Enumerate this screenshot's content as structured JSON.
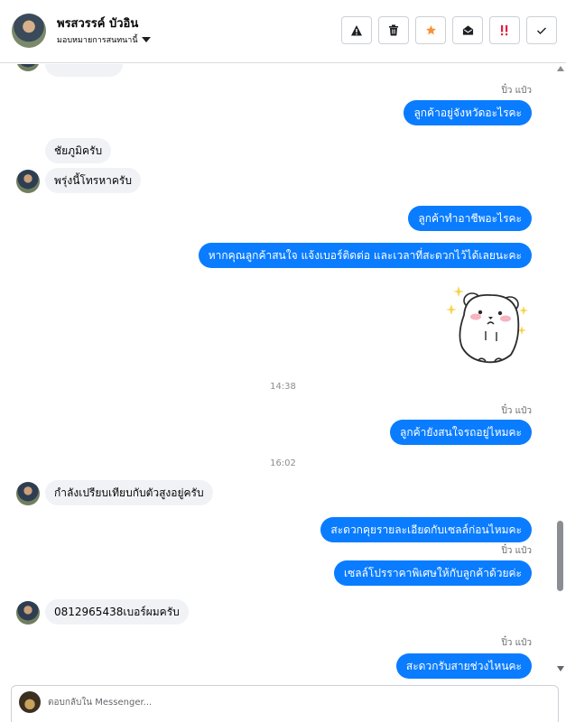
{
  "header": {
    "contact_name": "พรสวรรค์ บัวอิน",
    "assign_label": "มอบหมายการสนทนานี้",
    "actions": [
      {
        "name": "spam-button",
        "icon": "warning-icon"
      },
      {
        "name": "delete-button",
        "icon": "trash-icon"
      },
      {
        "name": "star-button",
        "icon": "star-icon",
        "color": "#f7923a"
      },
      {
        "name": "mark-unread-button",
        "icon": "envelope-open-icon"
      },
      {
        "name": "follow-up-button",
        "icon": "exclamation-icon",
        "color": "#e41e3f"
      },
      {
        "name": "mark-done-button",
        "icon": "check-icon"
      }
    ]
  },
  "messages": {
    "m1_sender": "ปิ๋ว แป๋ว",
    "m1": "ลูกค้าอยู่จังหวัดอะไรคะ",
    "m2": "ชัยภูมิครับ",
    "m3": "พรุ่งนี้โทรหาครับ",
    "m4": "ลูกค้าทำอาชีพอะไรคะ",
    "m5": "หากคุณลูกค้าสนใจ  แจ้งเบอร์ติดต่อ  และเวลาที่สะดวกไว้ได้เลยนะคะ",
    "time1": "14:38",
    "m6_sender": "ปิ๋ว แป๋ว",
    "m6": "ลูกค้ายังสนใจรถอยู่ไหมคะ",
    "time2": "16:02",
    "m7": "กำลังเปรียบเทียบกับตัวสูงอยู่ครับ",
    "m8": "สะดวกคุยรายละเอียดกับเซลล์ก่อนไหมคะ",
    "m9_sender": "ปิ๋ว แป๋ว",
    "m9": "เซลล์โปรราคาพิเศษให้กับลูกค้าด้วยค่ะ",
    "m10": "0812965438เบอร์ผมครับ",
    "m11_sender": "ปิ๋ว แป๋ว",
    "m11": "สะดวกรับสายช่วงไหนคะ"
  },
  "composer": {
    "placeholder": "ตอบกลับใน Messenger..."
  },
  "colors": {
    "outgoing_bubble": "#0a7cff",
    "incoming_bubble": "#f0f2f5"
  }
}
